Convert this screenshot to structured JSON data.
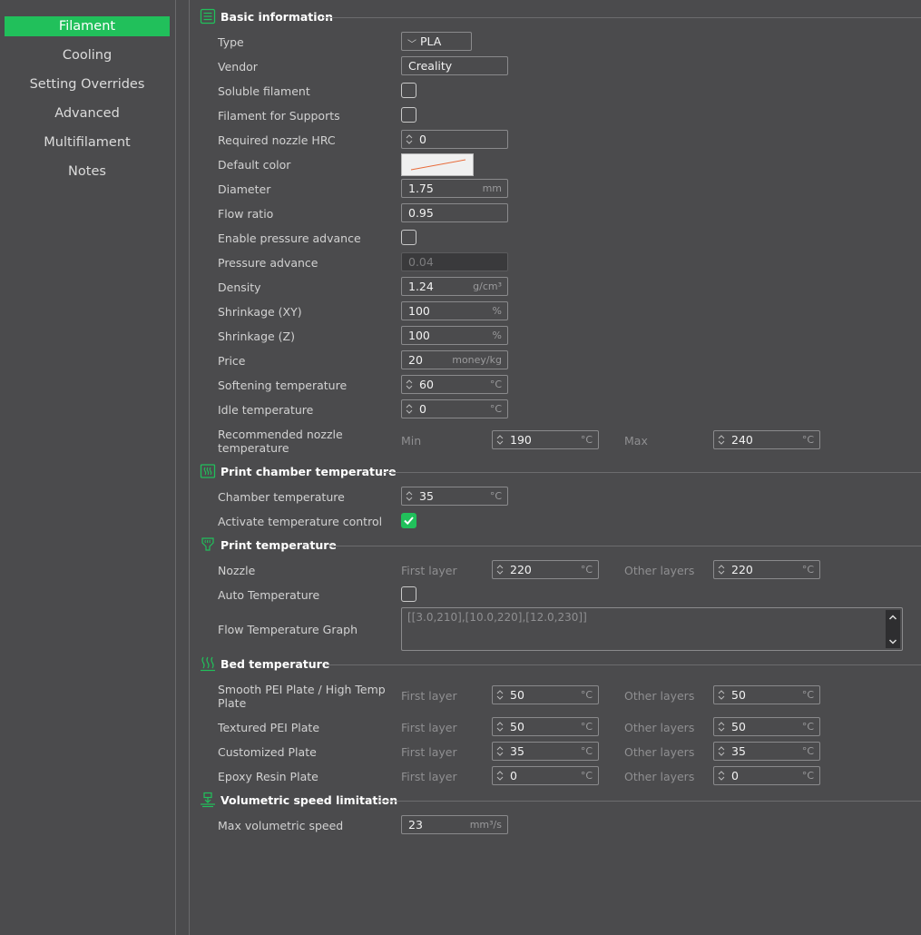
{
  "sidebar": {
    "items": [
      {
        "label": "Filament",
        "active": true
      },
      {
        "label": "Cooling"
      },
      {
        "label": "Setting Overrides"
      },
      {
        "label": "Advanced"
      },
      {
        "label": "Multifilament"
      },
      {
        "label": "Notes"
      }
    ]
  },
  "colors": {
    "accent": "#21c05b",
    "background": "#4b4b4d"
  },
  "basic": {
    "title": "Basic information",
    "type_label": "Type",
    "type_value": "PLA",
    "vendor_label": "Vendor",
    "vendor_value": "Creality",
    "soluble_label": "Soluble filament",
    "supports_label": "Filament for Supports",
    "hrc_label": "Required nozzle HRC",
    "hrc_value": "0",
    "color_label": "Default color",
    "diameter_label": "Diameter",
    "diameter_value": "1.75",
    "diameter_unit": "mm",
    "flow_label": "Flow ratio",
    "flow_value": "0.95",
    "pa_enable_label": "Enable pressure advance",
    "pa_label": "Pressure advance",
    "pa_value": "0.04",
    "density_label": "Density",
    "density_value": "1.24",
    "density_unit": "g/cm³",
    "shrink_xy_label": "Shrinkage (XY)",
    "shrink_xy_value": "100",
    "shrink_xy_unit": "%",
    "shrink_z_label": "Shrinkage (Z)",
    "shrink_z_value": "100",
    "shrink_z_unit": "%",
    "price_label": "Price",
    "price_value": "20",
    "price_unit": "money/kg",
    "soft_label": "Softening temperature",
    "soft_value": "60",
    "soft_unit": "°C",
    "idle_label": "Idle temperature",
    "idle_value": "0",
    "idle_unit": "°C",
    "rec_label_1": "Recommended nozzle",
    "rec_label_2": "temperature",
    "rec_min_label": "Min",
    "rec_min_value": "190",
    "rec_max_label": "Max",
    "rec_max_value": "240",
    "temp_unit": "°C"
  },
  "chamber": {
    "title": "Print chamber temperature",
    "temp_label": "Chamber temperature",
    "temp_value": "35",
    "unit": "°C",
    "control_label": "Activate temperature control"
  },
  "print_temp": {
    "title": "Print temperature",
    "nozzle_label": "Nozzle",
    "first_label": "First layer",
    "first_value": "220",
    "other_label": "Other layers",
    "other_value": "220",
    "unit": "°C",
    "auto_label": "Auto Temperature",
    "graph_label": "Flow Temperature Graph",
    "graph_value": "[[3.0,210],[10.0,220],[12.0,230]]"
  },
  "bed": {
    "title": "Bed temperature",
    "first_label": "First layer",
    "other_label": "Other layers",
    "unit": "°C",
    "plates": [
      {
        "name1": "Smooth PEI Plate / High Temp",
        "name2": "Plate",
        "first": "50",
        "other": "50"
      },
      {
        "name1": "Textured PEI Plate",
        "name2": "",
        "first": "50",
        "other": "50"
      },
      {
        "name1": "Customized Plate",
        "name2": "",
        "first": "35",
        "other": "35"
      },
      {
        "name1": "Epoxy Resin Plate",
        "name2": "",
        "first": "0",
        "other": "0"
      }
    ]
  },
  "volumetric": {
    "title": "Volumetric speed limitation",
    "max_label": "Max volumetric speed",
    "max_value": "23",
    "max_unit": "mm³/s"
  }
}
